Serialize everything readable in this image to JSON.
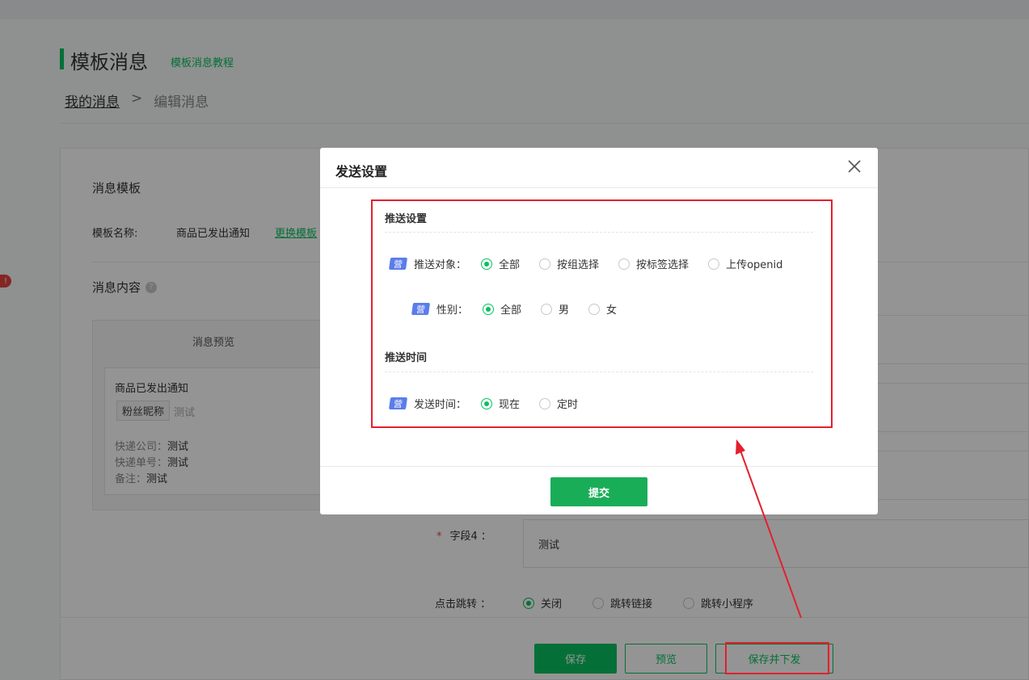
{
  "page": {
    "title": "模板消息",
    "title_link": "模板消息教程",
    "breadcrumb": {
      "parent": "我的消息",
      "separator": ">",
      "current": "编辑消息"
    }
  },
  "template": {
    "section_title": "消息模板",
    "name_label": "模板名称:",
    "name_value": "商品已发出通知",
    "change_link": "更换模板"
  },
  "content": {
    "section_title": "消息内容",
    "preview": {
      "header": "消息预览",
      "msg_title": "商品已发出通知",
      "tag": "粉丝昵称",
      "tag_value": "测试",
      "lines": [
        {
          "label": "快递公司：",
          "value": "测试"
        },
        {
          "label": "快递单号：",
          "value": "测试"
        },
        {
          "label": "备注：",
          "value": "测试"
        }
      ]
    },
    "field4": {
      "star": "*",
      "label": "字段4 ：",
      "value": "测试"
    },
    "jump": {
      "label": "点击跳转 ：",
      "options": [
        "关闭",
        "跳转链接",
        "跳转小程序"
      ],
      "selected": 0
    }
  },
  "buttons": {
    "save": "保存",
    "preview": "预览",
    "save_send": "保存并下发"
  },
  "dialog": {
    "title": "发送设置",
    "push_settings": {
      "title": "推送设置",
      "badge": "营",
      "target_label": "推送对象：",
      "target_options": [
        "全部",
        "按组选择",
        "按标签选择",
        "上传openid"
      ],
      "target_selected": 0,
      "gender_label": "性别：",
      "gender_options": [
        "全部",
        "男",
        "女"
      ],
      "gender_selected": 0
    },
    "push_time": {
      "title": "推送时间",
      "badge": "营",
      "label": "发送时间：",
      "options": [
        "现在",
        "定时"
      ],
      "selected": 0
    },
    "submit": "提交"
  },
  "colors": {
    "accent": "#07c160",
    "highlight": "#e3202d",
    "badge": "#5b7dea"
  }
}
